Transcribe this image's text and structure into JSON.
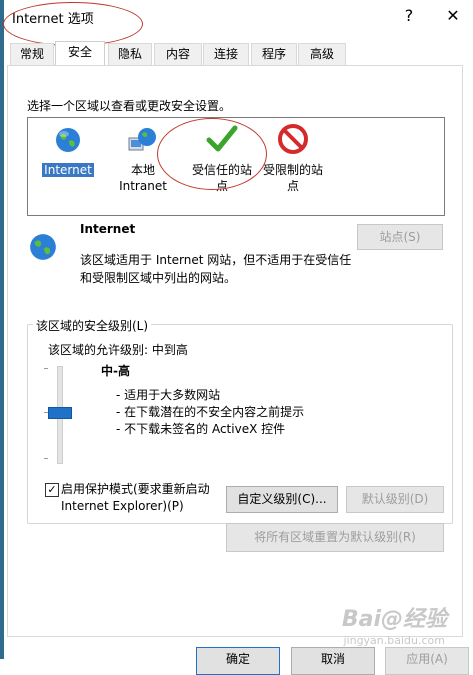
{
  "window": {
    "title": "Internet 选项",
    "help_glyph": "?",
    "close_glyph": "✕"
  },
  "tabs": [
    "常规",
    "安全",
    "隐私",
    "内容",
    "连接",
    "程序",
    "高级"
  ],
  "zones": {
    "prompt": "选择一个区域以查看或更改安全设置。",
    "items": [
      {
        "label": "Internet",
        "icon": "globe-icon"
      },
      {
        "label": "本地\nIntranet",
        "icon": "intranet-globe-icon"
      },
      {
        "label": "受信任的站\n点",
        "icon": "check-icon"
      },
      {
        "label": "受限制的站\n点",
        "icon": "no-entry-icon"
      }
    ]
  },
  "zone_info": {
    "title": "Internet",
    "description": "该区域适用于 Internet 网站，但不适用于在受信任和受限制区域中列出的网站。",
    "sites_button": "站点(S)"
  },
  "security_level": {
    "group_label": "该区域的安全级别(L)",
    "allowed_levels": "该区域的允许级别: 中到高",
    "level_name": "中-高",
    "bullets": [
      "- 适用于大多数网站",
      "- 在下载潜在的不安全内容之前提示",
      "- 不下载未签名的 ActiveX 控件"
    ],
    "protected_mode_label": "启用保护模式(要求重新启动\nInternet Explorer)(P)",
    "protected_mode_checked": true,
    "custom_level_button": "自定义级别(C)...",
    "default_level_button": "默认级别(D)",
    "reset_all_button": "将所有区域重置为默认级别(R)"
  },
  "footer": {
    "ok_button": "确定",
    "cancel_button": "取消",
    "apply_button": "应用(A)"
  },
  "watermark": {
    "text": "Bai@经验",
    "sub": "jingyan.baidu.com"
  },
  "colors": {
    "accent": "#1e73c8",
    "annotation": "#c0392b",
    "check": "#3aa52a",
    "no_entry": "#d42a2a"
  }
}
